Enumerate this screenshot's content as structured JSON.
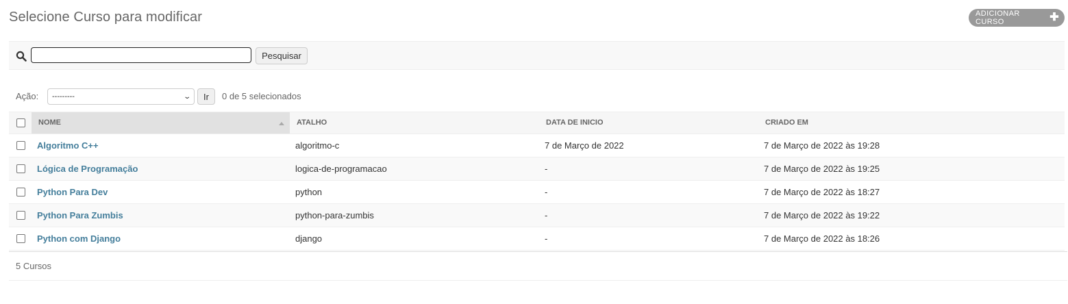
{
  "page": {
    "title": "Selecione Curso para modificar",
    "add_button": "ADICIONAR CURSO"
  },
  "search": {
    "value": "",
    "button": "Pesquisar"
  },
  "actions": {
    "label": "Ação:",
    "selected_option": "---------",
    "go_button": "Ir",
    "selection_status": "0 de 5 selecionados"
  },
  "table": {
    "headers": {
      "nome": "NOME",
      "atalho": "ATALHO",
      "data_inicio": "DATA DE INICIO",
      "criado_em": "CRIADO EM"
    },
    "sorted_column": "nome",
    "rows": [
      {
        "nome": "Algoritmo C++",
        "atalho": "algoritmo-c",
        "data_inicio": "7 de Março de 2022",
        "criado_em": "7 de Março de 2022 às 19:28",
        "checked": false
      },
      {
        "nome": "Lógica de Programação",
        "atalho": "logica-de-programacao",
        "data_inicio": "-",
        "criado_em": "7 de Março de 2022 às 19:25",
        "checked": false
      },
      {
        "nome": "Python Para Dev",
        "atalho": "python",
        "data_inicio": "-",
        "criado_em": "7 de Março de 2022 às 18:27",
        "checked": false
      },
      {
        "nome": "Python Para Zumbis",
        "atalho": "python-para-zumbis",
        "data_inicio": "-",
        "criado_em": "7 de Março de 2022 às 19:22",
        "checked": false
      },
      {
        "nome": "Python com Django",
        "atalho": "django",
        "data_inicio": "-",
        "criado_em": "7 de Março de 2022 às 18:26",
        "checked": false
      }
    ]
  },
  "footer": {
    "count": "5 Cursos"
  },
  "colors": {
    "link": "#447e9b",
    "button_bg": "#999999",
    "header_bg": "#f6f6f6"
  },
  "icons": {
    "search": "search-icon",
    "add": "plus-icon",
    "sort": "sort-ascending-icon"
  }
}
